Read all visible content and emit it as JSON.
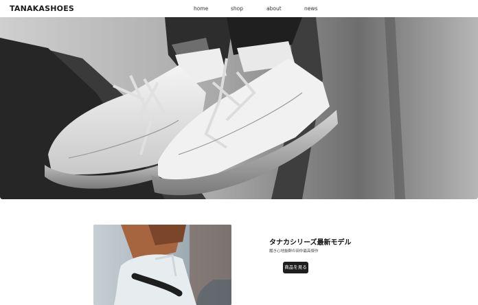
{
  "brand": {
    "name": "TANAKASHOES"
  },
  "nav": {
    "items": [
      {
        "label": "home"
      },
      {
        "label": "shop"
      },
      {
        "label": "about"
      },
      {
        "label": "news"
      }
    ]
  },
  "hero": {
    "image": "sneakers-on-concrete-wall-photo"
  },
  "featured": {
    "image": "nike-sneaker-photo",
    "title": "タナカシリーズ最新モデル",
    "subtitle": "履き心地抜群の田中最高傑作",
    "button_label": "商品を見る"
  }
}
